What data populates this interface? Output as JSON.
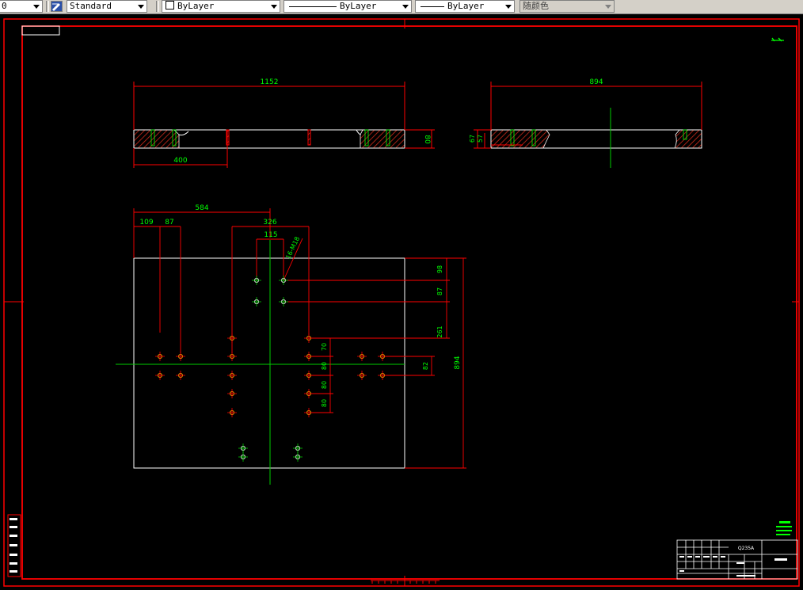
{
  "toolbar": {
    "layer_combo": "0",
    "dimstyle_combo": "Standard",
    "color_combo": "ByLayer",
    "linetype_combo": "ByLayer",
    "lineweight_combo": "ByLayer",
    "plotstyle_combo": "随颜色"
  },
  "drawing": {
    "top_view": {
      "overall_length": "1152",
      "partial_length": "400",
      "thickness": "80"
    },
    "side_view": {
      "overall_length": "894",
      "dim_a": "67",
      "dim_b": "57"
    },
    "plan_view": {
      "dim_584": "584",
      "dim_109": "109",
      "dim_87": "87",
      "dim_326": "326",
      "dim_115": "115",
      "hole_callout": "16-M18",
      "dim_98": "98",
      "dim_87_right": "87",
      "dim_261": "261",
      "dim_70": "70",
      "dim_80a": "80",
      "dim_80b": "80",
      "dim_80c": "80",
      "dim_82": "82",
      "dim_894": "894"
    },
    "title_block": {
      "material": "Q235A"
    }
  },
  "colors": {
    "frame": "#ff0000",
    "outline": "#ffffff",
    "dimension_text": "#00ff00",
    "centerline": "#00cc00",
    "hole": "#ffaa00",
    "hatch": "#cc0000"
  }
}
